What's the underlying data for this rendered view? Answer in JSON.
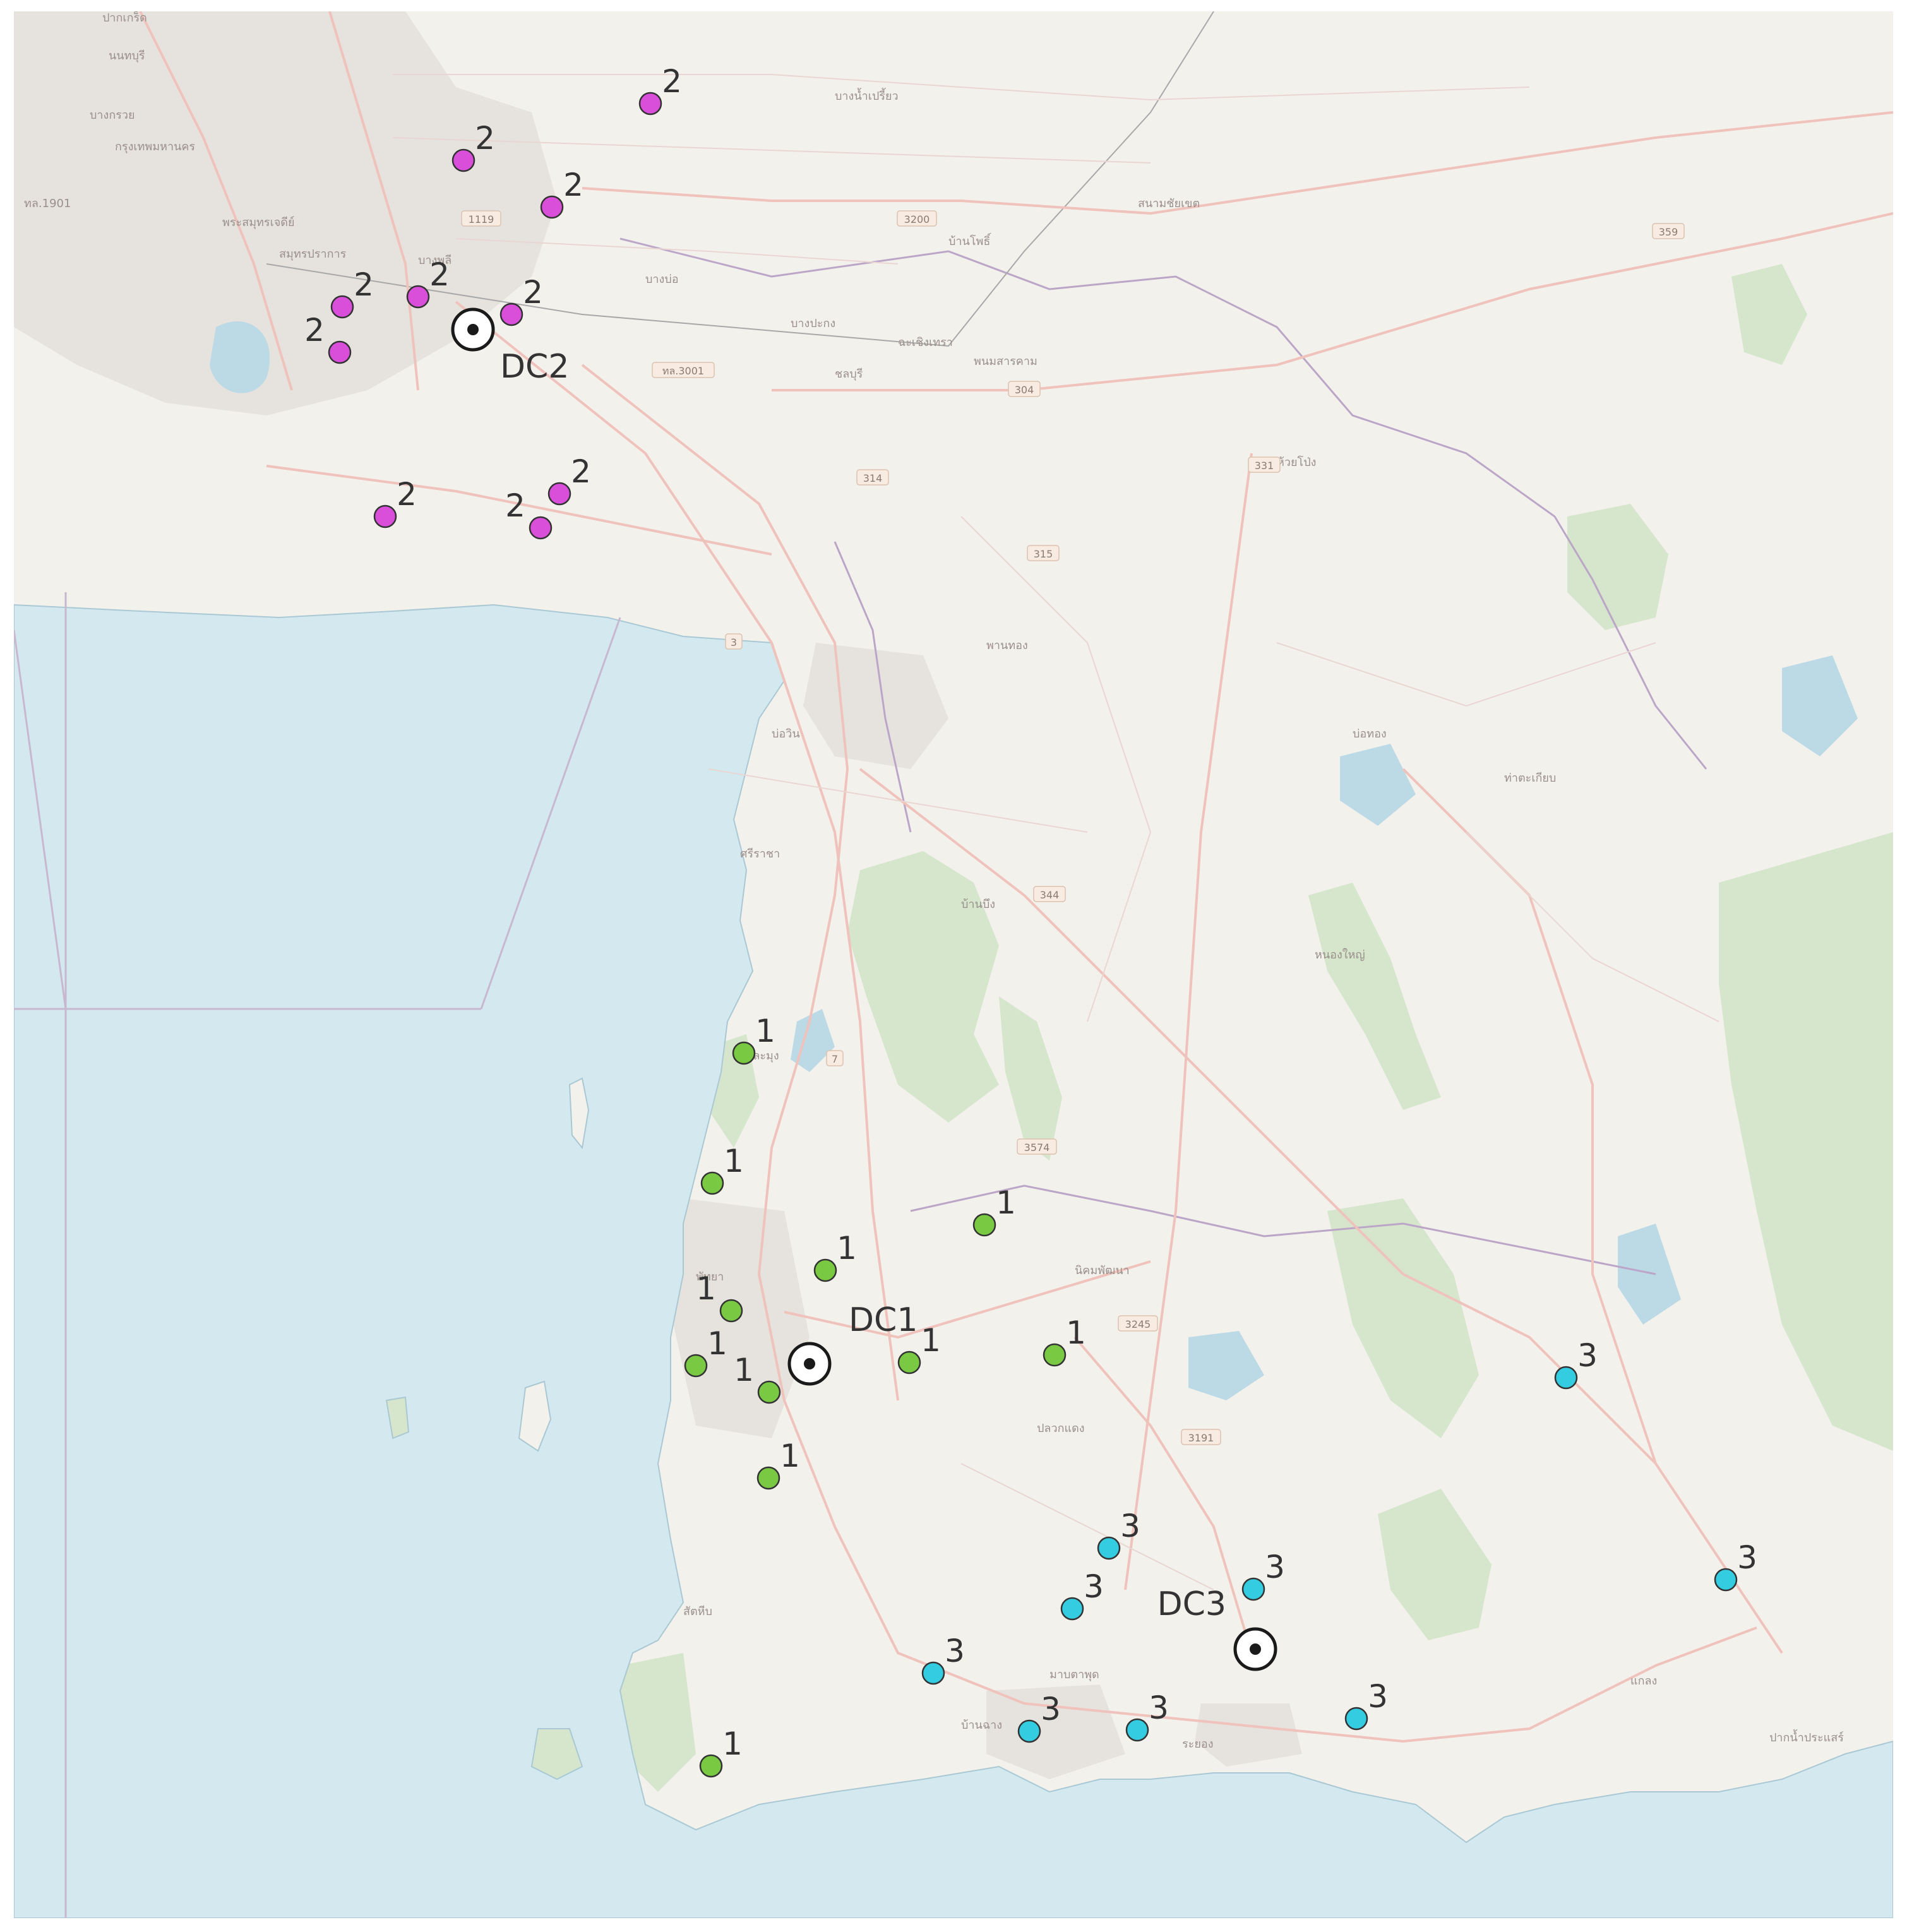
{
  "map": {
    "colors": {
      "land": "#f3f1ec",
      "sea": "#d4e9ef",
      "sea_line": "#a9c8d4",
      "park": "#d5e6cc",
      "urban": "#e6e3de",
      "road": "#efc2bb",
      "minor_road": "#e9d6d2",
      "border": "#b8a8c8",
      "water": "#bcd9e6",
      "depot_ring": "#1a1a1a"
    },
    "clusters": [
      {
        "id": "1",
        "color": "#7ac943",
        "count": 12
      },
      {
        "id": "2",
        "color": "#d94fd9",
        "count": 10
      },
      {
        "id": "3",
        "color": "#33cce0",
        "count": 10
      }
    ],
    "depots": [
      {
        "label": "DC1"
      },
      {
        "label": "DC2"
      },
      {
        "label": "DC3"
      }
    ],
    "place_labels": [
      "ปากเกร็ด",
      "นนทบุรี",
      "บางกรวย",
      "กรุงเทพมหานคร",
      "ทล.1901",
      "พระสมุทรเจดีย์",
      "สมุทรปราการ",
      "บางพลี",
      "บางบ่อ",
      "บางปะกง",
      "ชลบุรี",
      "ฉะเชิงเทรา",
      "พนมสารคาม",
      "บางน้ำเปรี้ยว",
      "บ้านโพธิ์",
      "สนามชัยเขต",
      "ศรีราชา",
      "บางละมุง",
      "พัทยา",
      "สัตหีบ",
      "บ้านฉาง",
      "มาบตาพุด",
      "ระยอง",
      "แกลง",
      "ปลวกแดง",
      "บ่อทอง",
      "หนองใหญ่",
      "บ้านบึง",
      "พานทอง",
      "บ่อวิน",
      "นิคมพัฒนา",
      "ท่าตะเกียบ",
      "ปากน้ำประแสร์",
      "ห้วยโป่ง"
    ],
    "road_refs": [
      "1119",
      "3200",
      "304",
      "314",
      "315",
      "331",
      "3191",
      "344",
      "3574",
      "3245",
      "7",
      "3",
      "359",
      "ทล.3001"
    ]
  }
}
